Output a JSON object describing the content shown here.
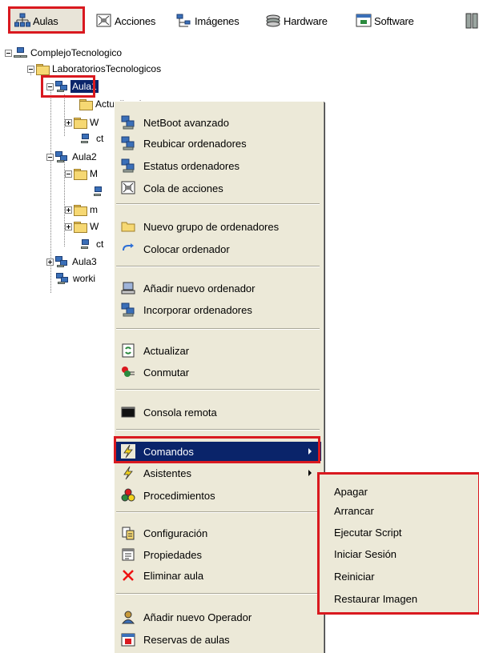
{
  "toolbar": {
    "items": [
      {
        "label": "Aulas",
        "icon": "network-icon"
      },
      {
        "label": "Acciones",
        "icon": "actions-icon"
      },
      {
        "label": "Imágenes",
        "icon": "images-icon"
      },
      {
        "label": "Hardware",
        "icon": "hardware-icon"
      },
      {
        "label": "Software",
        "icon": "software-icon"
      }
    ]
  },
  "tree": {
    "root": "ComplejoTecnologico",
    "lab": "LaboratoriosTecnologicos",
    "aula1": "Aula1",
    "aula1_child1": "Actualizaciones",
    "aula1_child2": "W",
    "aula1_child3": "ct",
    "aula2": "Aula2",
    "aula2_child1": "M",
    "aula2_child2": "m",
    "aula2_child3": "W",
    "aula2_child4": "ct",
    "aula3": "Aula3",
    "working": "worki"
  },
  "menu": {
    "netboot": "NetBoot avanzado",
    "reubicar": "Reubicar ordenadores",
    "estatus": "Estatus ordenadores",
    "cola": "Cola de acciones",
    "nuevo_grupo": "Nuevo grupo de ordenadores",
    "colocar": "Colocar ordenador",
    "anadir_ordenador": "Añadir nuevo ordenador",
    "incorporar": "Incorporar ordenadores",
    "actualizar": "Actualizar",
    "conmutar": "Conmutar",
    "consola": "Consola remota",
    "comandos": "Comandos",
    "asistentes": "Asistentes",
    "procedimientos": "Procedimientos",
    "configuracion": "Configuración",
    "propiedades": "Propiedades",
    "eliminar": "Eliminar aula",
    "anadir_operador": "Añadir nuevo Operador",
    "reservas": "Reservas de aulas"
  },
  "submenu": {
    "items": [
      "Apagar",
      "Arrancar",
      "Ejecutar Script",
      "Iniciar Sesión",
      "Reiniciar",
      "Restaurar Imagen"
    ]
  },
  "colors": {
    "highlight": "#0a246a",
    "menu_bg": "#ece9d8",
    "annotation_red": "#d9191f"
  }
}
